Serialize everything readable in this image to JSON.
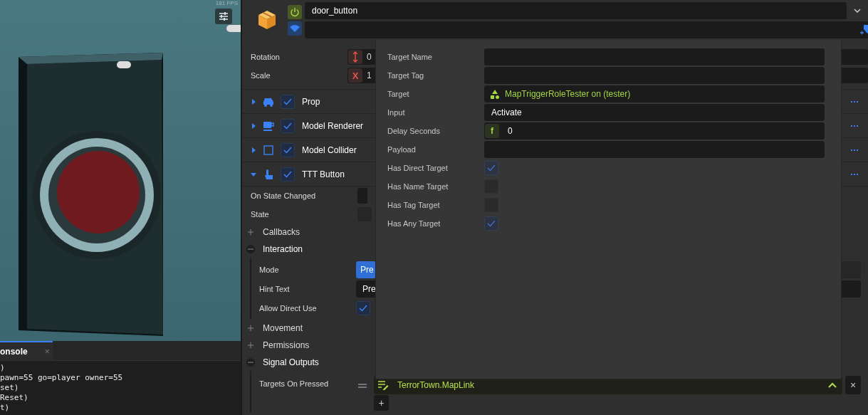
{
  "viewport": {
    "fps": "181 FPS"
  },
  "console": {
    "tab": "onsole",
    "close": "×",
    "lines": [
      ")",
      "pawn=55 go=player owner=55",
      "set)",
      "Reset)",
      "t)"
    ]
  },
  "header": {
    "name": "door_button",
    "enabled": true
  },
  "transform": [
    {
      "label": "Rotation",
      "kind": "arrow",
      "value": "0"
    },
    {
      "label": "Scale",
      "kind": "letter",
      "axis": "X",
      "value": "1"
    }
  ],
  "components": [
    {
      "name": "Prop",
      "kind": "car",
      "enabled": true,
      "expanded": false
    },
    {
      "name": "Model Renderer",
      "kind": "mug",
      "enabled": true,
      "expanded": false
    },
    {
      "name": "Model Collider",
      "kind": "square",
      "enabled": true,
      "expanded": false
    },
    {
      "name": "TTT Button",
      "kind": "hand",
      "enabled": true,
      "expanded": true
    }
  ],
  "properties": [
    {
      "kind": "event",
      "label": "On State Changed"
    },
    {
      "kind": "check",
      "label": "State",
      "checked": false
    }
  ],
  "groups": [
    {
      "label": "Callbacks",
      "expanded": false
    },
    {
      "label": "Interaction",
      "expanded": true,
      "fields": [
        {
          "kind": "segmented",
          "label": "Mode",
          "options": [
            {
              "label": "Pre",
              "selected": true
            }
          ]
        },
        {
          "kind": "text",
          "label": "Hint Text",
          "value": "Pre"
        },
        {
          "kind": "check",
          "label": "Allow Direct Use",
          "checked": true
        }
      ]
    },
    {
      "label": "Movement",
      "expanded": false
    },
    {
      "label": "Permissions",
      "expanded": false
    },
    {
      "label": "Signal Outputs",
      "expanded": true,
      "fields": [
        {
          "kind": "targets",
          "label": "Targets On Pressed",
          "items": [
            {
              "name": "TerrorTown.MapLink",
              "expanded": true,
              "close": "×"
            }
          ],
          "add": "+"
        }
      ]
    }
  ],
  "popup": {
    "fields": [
      {
        "kind": "text",
        "label": "Target Name"
      },
      {
        "kind": "text",
        "label": "Target Tag"
      },
      {
        "kind": "object",
        "label": "Target",
        "value": "MapTriggerRoleTester on (tester)"
      },
      {
        "kind": "text",
        "label": "Input",
        "value": "Activate"
      },
      {
        "kind": "float",
        "label": "Delay Seconds",
        "prefix": "f",
        "value": "0"
      },
      {
        "kind": "text",
        "label": "Payload"
      },
      {
        "kind": "check",
        "label": "Has Direct Target",
        "checked": true
      },
      {
        "kind": "check",
        "label": "Has Name Target",
        "checked": false
      },
      {
        "kind": "check",
        "label": "Has Tag Target",
        "checked": false
      },
      {
        "kind": "check",
        "label": "Has Any Target",
        "checked": true
      }
    ]
  }
}
